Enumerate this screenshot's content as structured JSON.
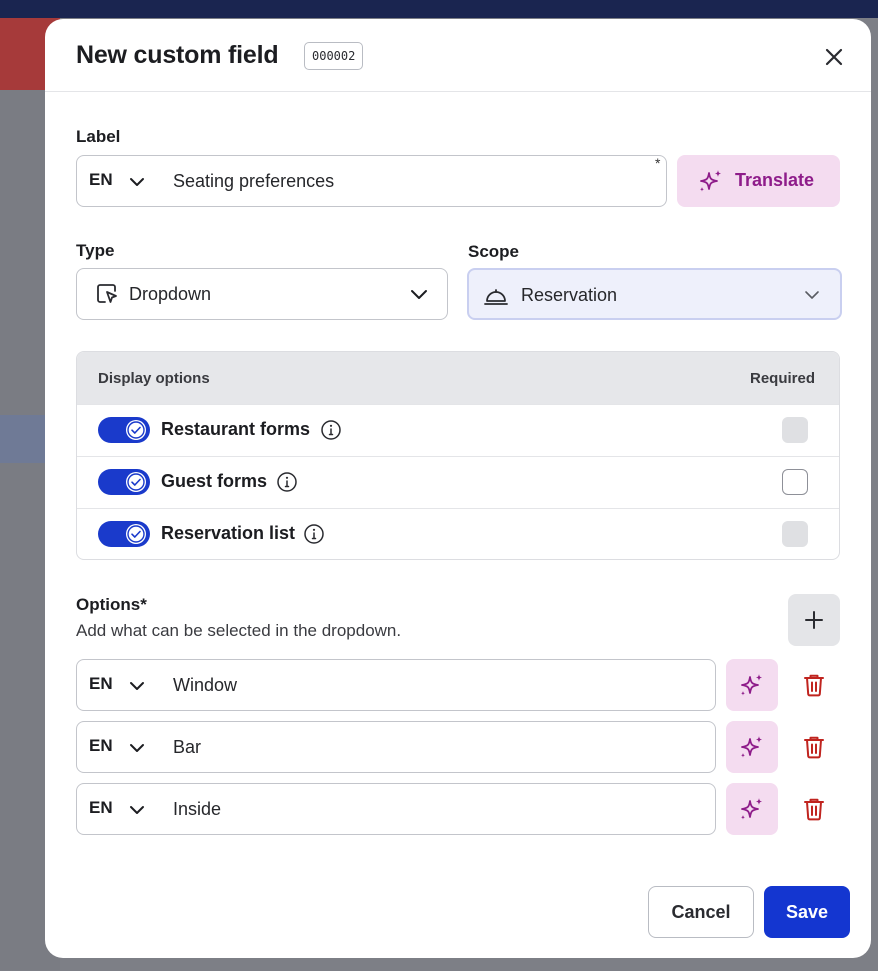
{
  "dialog": {
    "title": "New custom field",
    "field_id": "000002"
  },
  "label_field": {
    "label": "Label",
    "language": "EN",
    "value": "Seating preferences",
    "required_mark": "*",
    "translate_label": "Translate"
  },
  "type_field": {
    "label": "Type",
    "value": "Dropdown"
  },
  "scope_field": {
    "label": "Scope",
    "value": "Reservation"
  },
  "display_options": {
    "header": "Display options",
    "required_header": "Required",
    "rows": [
      {
        "label": "Restaurant forms",
        "enabled": true,
        "required_state": "disabled"
      },
      {
        "label": "Guest forms",
        "enabled": true,
        "required_state": "unchecked"
      },
      {
        "label": "Reservation list",
        "enabled": true,
        "required_state": "disabled"
      }
    ]
  },
  "options": {
    "title": "Options*",
    "description": "Add what can be selected in the dropdown.",
    "items": [
      {
        "language": "EN",
        "value": "Window"
      },
      {
        "language": "EN",
        "value": "Bar"
      },
      {
        "language": "EN",
        "value": "Inside"
      }
    ]
  },
  "footer": {
    "cancel_label": "Cancel",
    "save_label": "Save"
  },
  "colors": {
    "primary": "#1436d0",
    "magic_bg": "#f4dcf0",
    "magic_fg": "#8e1c8a",
    "danger": "#c0241f"
  }
}
